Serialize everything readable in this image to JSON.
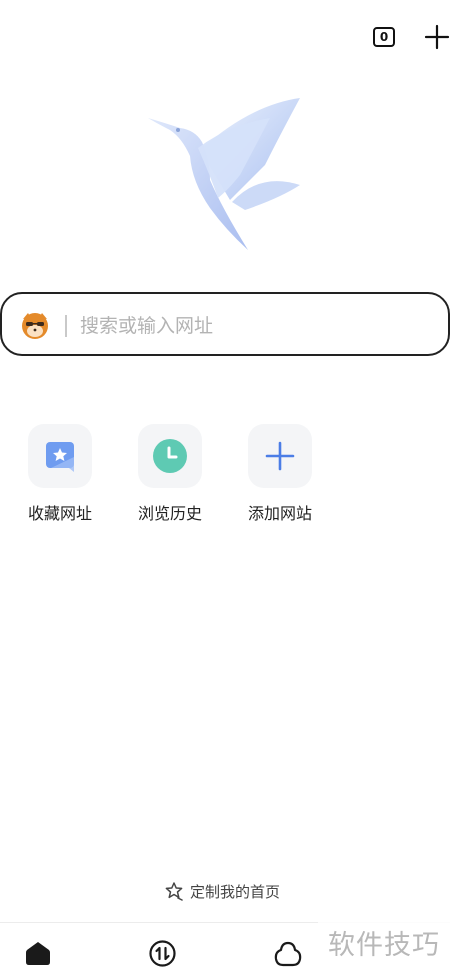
{
  "header": {
    "tab_count": "0"
  },
  "search": {
    "placeholder": "搜索或输入网址"
  },
  "shortcuts": [
    {
      "label": "收藏网址",
      "icon": "bookmark-star-icon"
    },
    {
      "label": "浏览历史",
      "icon": "history-clock-icon"
    },
    {
      "label": "添加网站",
      "icon": "add-icon"
    }
  ],
  "customize": {
    "label": "定制我的首页",
    "icon": "customize-star-icon"
  },
  "bottom_nav": [
    {
      "icon": "home-icon"
    },
    {
      "icon": "transfer-icon"
    },
    {
      "icon": "cloud-icon"
    }
  ],
  "watermark": {
    "text": "软件技巧"
  },
  "colors": {
    "accent_blue": "#4b7de6",
    "teal": "#5ecab3",
    "mascot_orange": "#e48a2a"
  }
}
